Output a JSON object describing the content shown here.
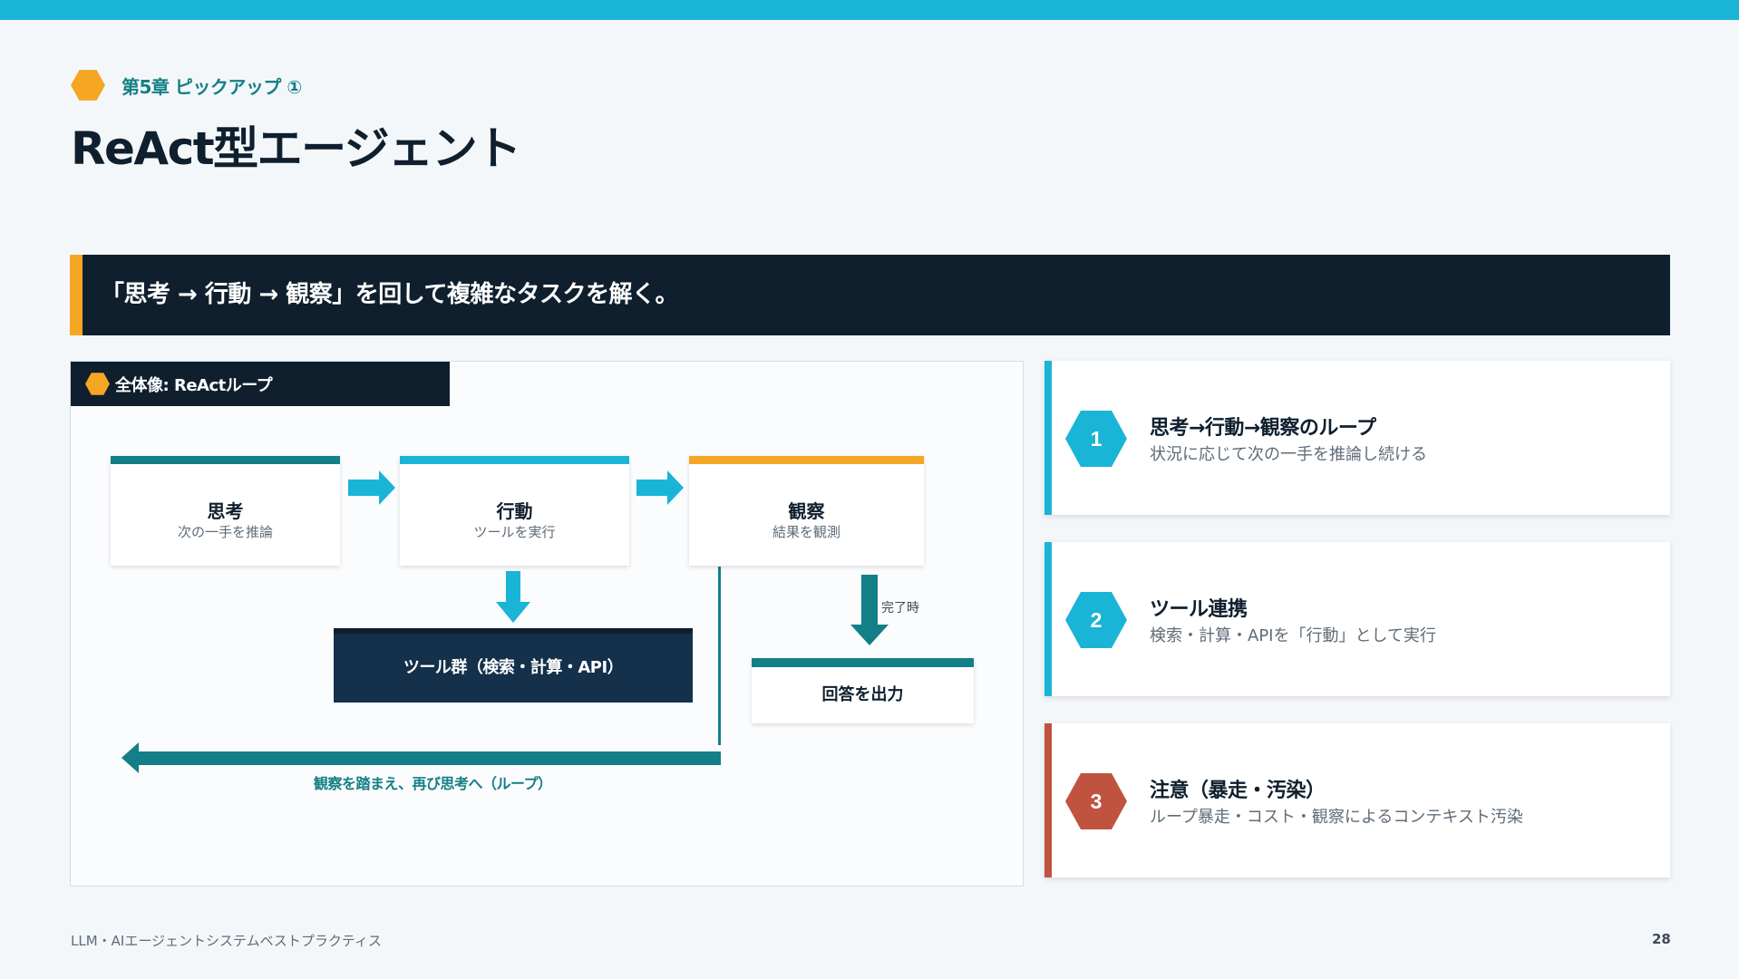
{
  "colors": {
    "accent_cyan": "#1ab4d7",
    "accent_teal": "#137f86",
    "accent_orange": "#f5a623",
    "accent_red": "#c0533f",
    "navy": "#0f1f2e",
    "navy_box": "#14304a"
  },
  "header": {
    "chapter": "第5章 ピックアップ ①",
    "title": "ReAct型エージェント"
  },
  "banner": {
    "text": "「思考 → 行動 → 観察」を回して複雑なタスクを解く。"
  },
  "diagram": {
    "tab_label": "全体像: ReActループ",
    "nodes": [
      {
        "title": "思考",
        "sub": "次の一手を推論"
      },
      {
        "title": "行動",
        "sub": "ツールを実行"
      },
      {
        "title": "観察",
        "sub": "結果を観測"
      }
    ],
    "tools_label": "ツール群（検索・計算・API）",
    "done_label": "完了時",
    "answer_label": "回答を出力",
    "loop_label": "観察を踏まえ、再び思考へ（ループ）"
  },
  "cards": [
    {
      "number": "1",
      "title": "思考→行動→観察のループ",
      "desc": "状況に応じて次の一手を推論し続ける"
    },
    {
      "number": "2",
      "title": "ツール連携",
      "desc": "検索・計算・APIを「行動」として実行"
    },
    {
      "number": "3",
      "title": "注意（暴走・汚染）",
      "desc": "ループ暴走・コスト・観察によるコンテキスト汚染"
    }
  ],
  "footer": {
    "left": "LLM・AIエージェントシステムベストプラクティス",
    "page": "28"
  }
}
